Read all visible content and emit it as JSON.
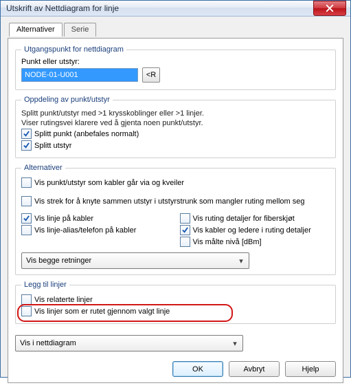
{
  "window": {
    "title": "Utskrift av Nettdiagram for linje"
  },
  "tabs": {
    "t0": "Alternativer",
    "t1": "Serie"
  },
  "start": {
    "legend": "Utgangspunkt for nettdiagram",
    "label": "Punkt eller utstyr:",
    "value": "NODE-01-U001",
    "btn": "<R"
  },
  "split": {
    "legend": "Oppdeling av punkt/utstyr",
    "desc1": "Splitt punkt/utstyr med >1 krysskoblinger eller >1 linjer.",
    "desc2": "Viser rutingsvei klarere ved å gjenta noen punkt/utstyr.",
    "cb1": "Splitt punkt (anbefales normalt)",
    "cb2": "Splitt utstyr"
  },
  "alt": {
    "legend": "Alternativer",
    "cb_via": "Vis punkt/utstyr som kabler går via og kveiler",
    "cb_strek": "Vis strek for å knyte sammen utstyr i utstyrstrunk som mangler ruting mellom seg",
    "cb_l1": "Vis linje på kabler",
    "cb_l2": "Vis linje-alias/telefon på kabler",
    "cb_r1": "Vis ruting detaljer for fiberskjøt",
    "cb_r2": "Vis kabler og ledere i ruting detaljer",
    "cb_r3": "Vis målte nivå [dBm]",
    "combo": "Vis begge retninger"
  },
  "legg": {
    "legend": "Legg til linjer",
    "cb1": "Vis relaterte linjer",
    "cb2": "Vis linjer som er rutet gjennom valgt linje"
  },
  "combo2": "Vis i nettdiagram",
  "buttons": {
    "ok": "OK",
    "cancel": "Avbryt",
    "help": "Hjelp"
  }
}
